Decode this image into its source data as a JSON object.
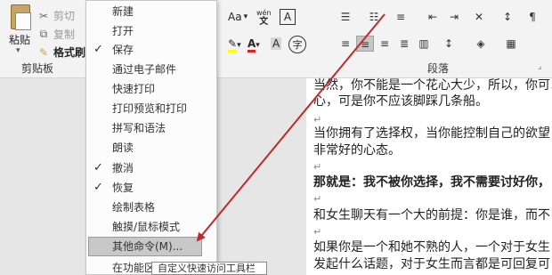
{
  "clipboard": {
    "paste_label": "粘贴",
    "cut_label": "剪切",
    "copy_label": "复制",
    "format_painter_label": "格式刷",
    "group_label": "剪贴板"
  },
  "font_group": {
    "aa_label": "Aa",
    "pinyin_label": "wén"
  },
  "paragraph": {
    "group_label": "段落"
  },
  "menu": {
    "items": [
      {
        "label": "新建",
        "checked": false
      },
      {
        "label": "打开",
        "checked": false
      },
      {
        "label": "保存",
        "checked": true
      },
      {
        "label": "通过电子邮件",
        "checked": false
      },
      {
        "label": "快速打印",
        "checked": false
      },
      {
        "label": "打印预览和打印",
        "checked": false
      },
      {
        "label": "拼写和语法",
        "checked": false
      },
      {
        "label": "朗读",
        "checked": false
      },
      {
        "label": "撤消",
        "checked": true
      },
      {
        "label": "恢复",
        "checked": true
      },
      {
        "label": "绘制表格",
        "checked": false
      },
      {
        "label": "触摸/鼠标模式",
        "checked": false
      },
      {
        "label": "其他命令(M)...",
        "checked": false,
        "highlighted": true
      },
      {
        "label": "在功能区下方显示",
        "checked": false
      }
    ]
  },
  "tooltip": {
    "text": "自定义快速访问工具栏"
  },
  "document": {
    "paragraphs": [
      {
        "text": "当然，你不能是一个花心大少，所以，你可以",
        "bold": false
      },
      {
        "text": "心，可是你不应该脚踩几条船。",
        "bold": false
      },
      {
        "text": "当你拥有了选择权，当你能控制自己的欲望",
        "bold": false
      },
      {
        "text": "非常好的心态。",
        "bold": false
      },
      {
        "text": "那就是：我不被你选择，我不需要讨好你，",
        "bold": true
      },
      {
        "text": "和女生聊天有一个大的前提：你是谁，而不",
        "bold": false
      },
      {
        "text": "如果你是一个和她不熟的人，一个对于女生",
        "bold": false
      },
      {
        "text": "发起什么话题，对于女生而言都是可回复可",
        "bold": false
      }
    ]
  },
  "colors": {
    "arrow": "#c0282a",
    "font_color_red": "#e02020",
    "highlight_yellow": "#ffff00"
  }
}
